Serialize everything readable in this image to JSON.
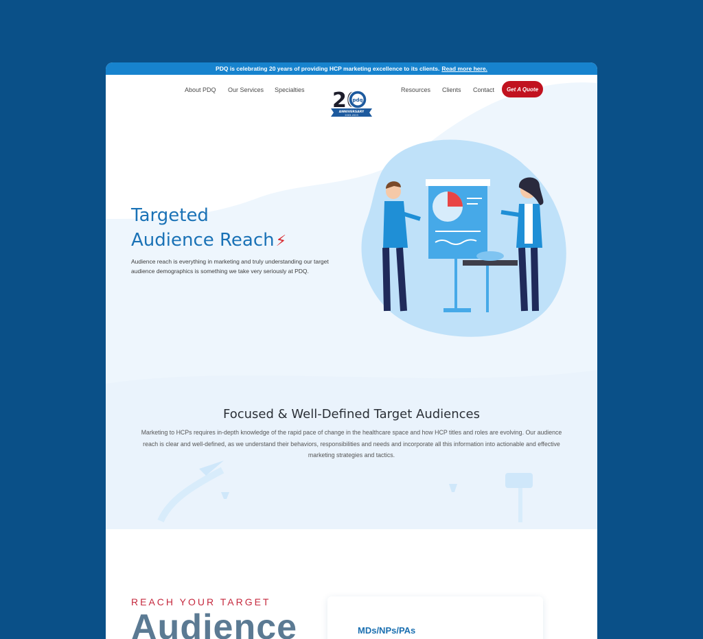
{
  "announcement": {
    "text": "PDQ is celebrating 20 years of providing HCP marketing excellence to its clients.",
    "link": "Read more here."
  },
  "nav": {
    "left": [
      "About PDQ",
      "Our Services",
      "Specialties"
    ],
    "right": [
      "Resources",
      "Clients",
      "Contact"
    ],
    "cta": "Get A Quote",
    "logo": {
      "number": "20",
      "badge": "pdq",
      "ribbon": "ANNIVERSARY",
      "years": "2003-2023"
    }
  },
  "hero": {
    "title_line1": "Targeted",
    "title_line2": "Audience Reach",
    "body": "Audience reach is everything in marketing and truly understanding our target audience demographics is something we take very seriously at PDQ."
  },
  "focus": {
    "title": "Focused & Well-Defined Target Audiences",
    "body": "Marketing to HCPs requires in-depth knowledge of the rapid pace of change in the healthcare space and how HCP titles and roles are evolving. Our audience reach is clear and well-defined, as we understand their behaviors, responsibilities and needs and incorporate all this information into actionable and effective marketing strategies and tactics."
  },
  "reach": {
    "label": "REACH YOUR TARGET",
    "big": "Audience",
    "card_title": "MDs/NPs/PAs"
  },
  "colors": {
    "page_bg": "#0a5088",
    "topbar": "#1783ce",
    "brand_blue": "#1a72b6",
    "cta_red": "#c1121f",
    "accent_red": "#c5283d"
  }
}
